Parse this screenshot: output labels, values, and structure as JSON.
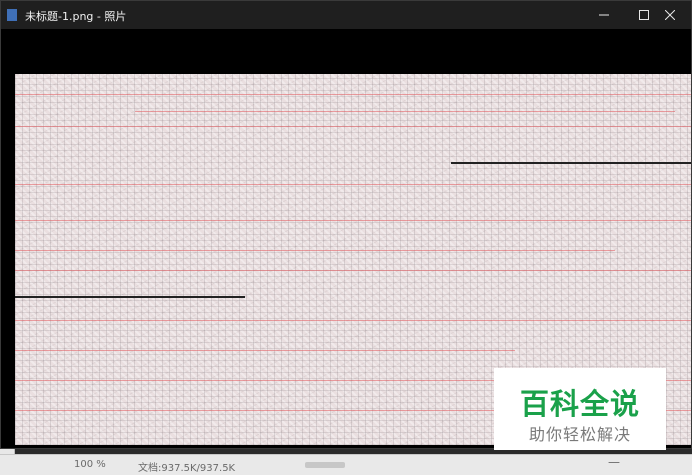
{
  "window": {
    "title": "未标题-1.png - 照片",
    "minimize_icon": "minimize-icon",
    "maximize_icon": "maximize-icon",
    "close_icon": "close-icon"
  },
  "watermark": {
    "title": "百科全说",
    "subtitle": "助你轻松解决"
  },
  "background_status": {
    "zoom": "100 %",
    "doc": "文档:937.5K/937.5K"
  },
  "colors": {
    "titlebar": "#1f1f1f",
    "watermark_green": "#1aa14a",
    "photo_base": "#eadfe0"
  }
}
